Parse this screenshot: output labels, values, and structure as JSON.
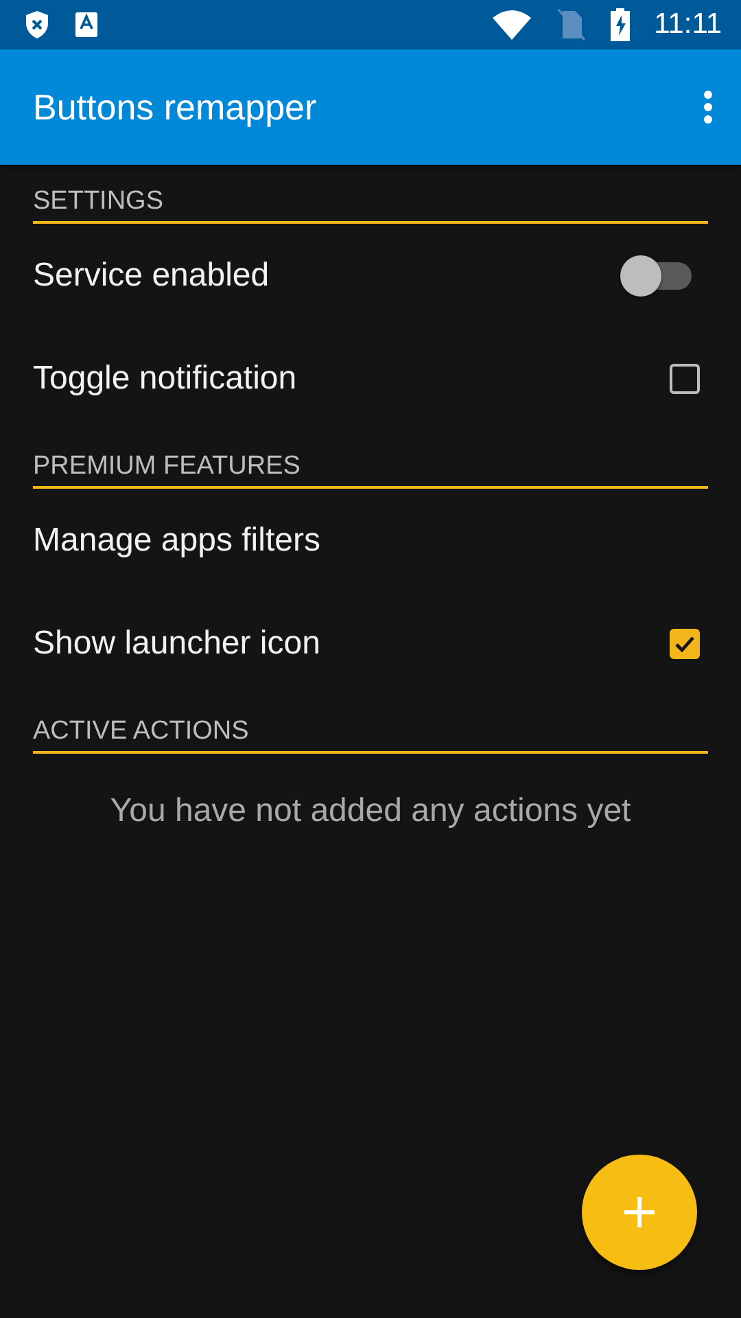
{
  "status_bar": {
    "time": "11:11"
  },
  "app_bar": {
    "title": "Buttons remapper"
  },
  "sections": [
    {
      "header": "SETTINGS",
      "items": [
        {
          "kind": "switch",
          "label": "Service enabled",
          "on": false
        },
        {
          "kind": "checkbox",
          "label": "Toggle notification",
          "checked": false
        }
      ]
    },
    {
      "header": "PREMIUM FEATURES",
      "items": [
        {
          "kind": "plain",
          "label": "Manage apps filters"
        },
        {
          "kind": "checkbox",
          "label": "Show launcher icon",
          "checked": true
        }
      ]
    },
    {
      "header": "ACTIVE ACTIONS",
      "items": [
        {
          "kind": "message",
          "label": "You have not added any actions yet"
        }
      ]
    }
  ]
}
